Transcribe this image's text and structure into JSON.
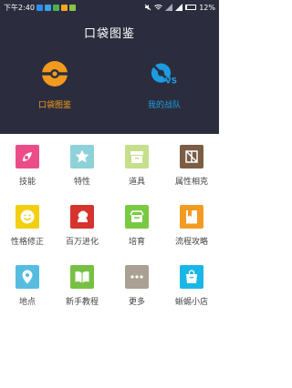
{
  "status": {
    "time": "下午2:40",
    "battery": "12%",
    "battery_level": 0.12
  },
  "header": {
    "title": "口袋图鉴"
  },
  "tabs": [
    {
      "label": "口袋图鉴",
      "icon": "pokeball-icon",
      "color": "#f29a1d"
    },
    {
      "label": "我的战队",
      "icon": "versus-icon",
      "color": "#1c9ce0"
    }
  ],
  "grid": [
    {
      "label": "技能",
      "icon": "skill-icon",
      "color": "#ec4d89"
    },
    {
      "label": "特性",
      "icon": "star-icon",
      "color": "#8ed2d9"
    },
    {
      "label": "道具",
      "icon": "box-icon",
      "color": "#c5df8b"
    },
    {
      "label": "属性相克",
      "icon": "element-relations-icon",
      "color": "#7b5d45"
    },
    {
      "label": "性格修正",
      "icon": "smiley-icon",
      "color": "#f2cf0f"
    },
    {
      "label": "百万进化",
      "icon": "evolution-icon",
      "color": "#d6332e"
    },
    {
      "label": "培育",
      "icon": "nest-icon",
      "color": "#7ac943"
    },
    {
      "label": "流程攻略",
      "icon": "book-icon",
      "color": "#f29b23"
    },
    {
      "label": "地点",
      "icon": "location-pin-icon",
      "color": "#56bde0"
    },
    {
      "label": "新手教程",
      "icon": "open-book-icon",
      "color": "#76c043"
    },
    {
      "label": "更多",
      "icon": "more-dots-icon",
      "color": "#aaa093"
    },
    {
      "label": "蜥蜴小店",
      "icon": "shopping-bag-icon",
      "color": "#1ab7e6"
    }
  ]
}
